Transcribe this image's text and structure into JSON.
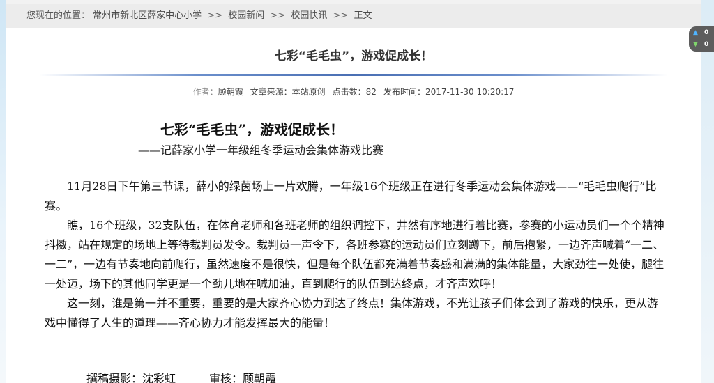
{
  "breadcrumb": {
    "prefix": "您现在的位置：",
    "items": [
      "常州市新北区薛家中心小学",
      "校园新闻",
      "校园快讯",
      "正文"
    ],
    "separator": ">>"
  },
  "article": {
    "title": "七彩“毛毛虫”，游戏促成长！",
    "meta": {
      "author_label": "作者：",
      "author": "顾朝霞",
      "source_label": "文章来源：",
      "source": "本站原创",
      "clicks_label": "点击数：",
      "clicks": "82",
      "time_label": "发布时间：",
      "time": "2017-11-30 10:20:17"
    },
    "body_title": "七彩“毛毛虫”，游戏促成长！",
    "body_subtitle": "——记薛家小学一年级组冬季运动会集体游戏比赛",
    "paragraphs": [
      "11月28日下午第三节课，薛小的绿茵场上一片欢腾，一年级16个班级正在进行冬季运动会集体游戏——“毛毛虫爬行”比赛。",
      "瞧，16个班级，32支队伍，在体育老师和各班老师的组织调控下，井然有序地进行着比赛，参赛的小运动员们一个个精神抖擞，站在规定的场地上等待裁判员发令。裁判员一声令下，各班参赛的运动员们立刻蹲下，前后抱紧，一边齐声喊着“一二、一二”，一边有节奏地向前爬行，虽然速度不是很快，但是每个队伍都充满着节奏感和满满的集体能量，大家劲往一处使，腿往一处迈，场下的其他同学更是一个劲儿地在喊加油，直到爬行的队伍到达终点，才齐声欢呼！",
      "这一刻，谁是第一并不重要，重要的是大家齐心协力到达了终点！集体游戏，不光让孩子们体会到了游戏的快乐，更从游戏中懂得了人生的道理——齐心协力才能发挥最大的能量！"
    ],
    "credits": {
      "writer": "撰稿摄影：沈彩虹",
      "reviewer": "审核：顾朝霞"
    }
  },
  "side_widget": {
    "up_icon": "arrow-up-icon",
    "down_icon": "arrow-down-icon",
    "up_value": "0",
    "down_value": "0",
    "up_color": "#4fb3ff",
    "down_color": "#7fd46b"
  }
}
